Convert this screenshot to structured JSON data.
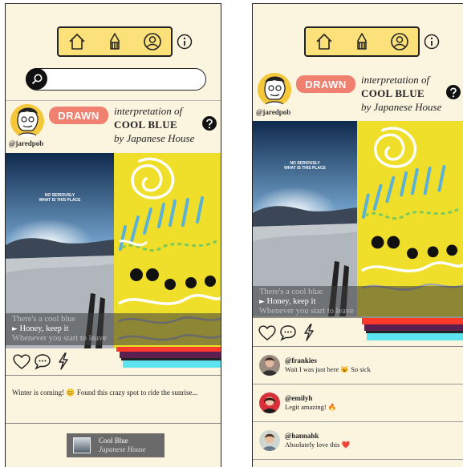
{
  "post": {
    "handle": "@jaredpob",
    "badge": "DRAWN",
    "interp_prefix": "interpretation of",
    "song": "COOL BLUE",
    "by": "by Japanese House",
    "photo_caption_1": "NO SERIOUSLY",
    "photo_caption_2": "WHAT IS THIS PLACE",
    "lyrics": [
      "There's a cool blue",
      "Honey, keep it",
      "Whenever you start to leave"
    ],
    "description": "Winter is coming! 😊 Found this crazy spot to ride the sunrise...",
    "chip_title": "Cool Blue",
    "chip_artist": "Japanese House"
  },
  "search": {
    "placeholder": ""
  },
  "comments": [
    {
      "user": "@frankies",
      "text": "Wait I was just here 😺 So sick"
    },
    {
      "user": "@emilyh",
      "text": "Legit amazing! 🔥"
    },
    {
      "user": "@hannahk",
      "text": "Absolutely love this ❤️"
    }
  ],
  "icons": [
    "home-icon",
    "pen-nib-icon",
    "profile-icon",
    "info-icon",
    "search-icon",
    "help-icon",
    "heart-icon",
    "comment-icon",
    "lightning-icon"
  ],
  "colors": {
    "accent": "#fce07a",
    "badge": "#f08070",
    "background": "#fbf4df",
    "drawing": "#efdf2a"
  }
}
